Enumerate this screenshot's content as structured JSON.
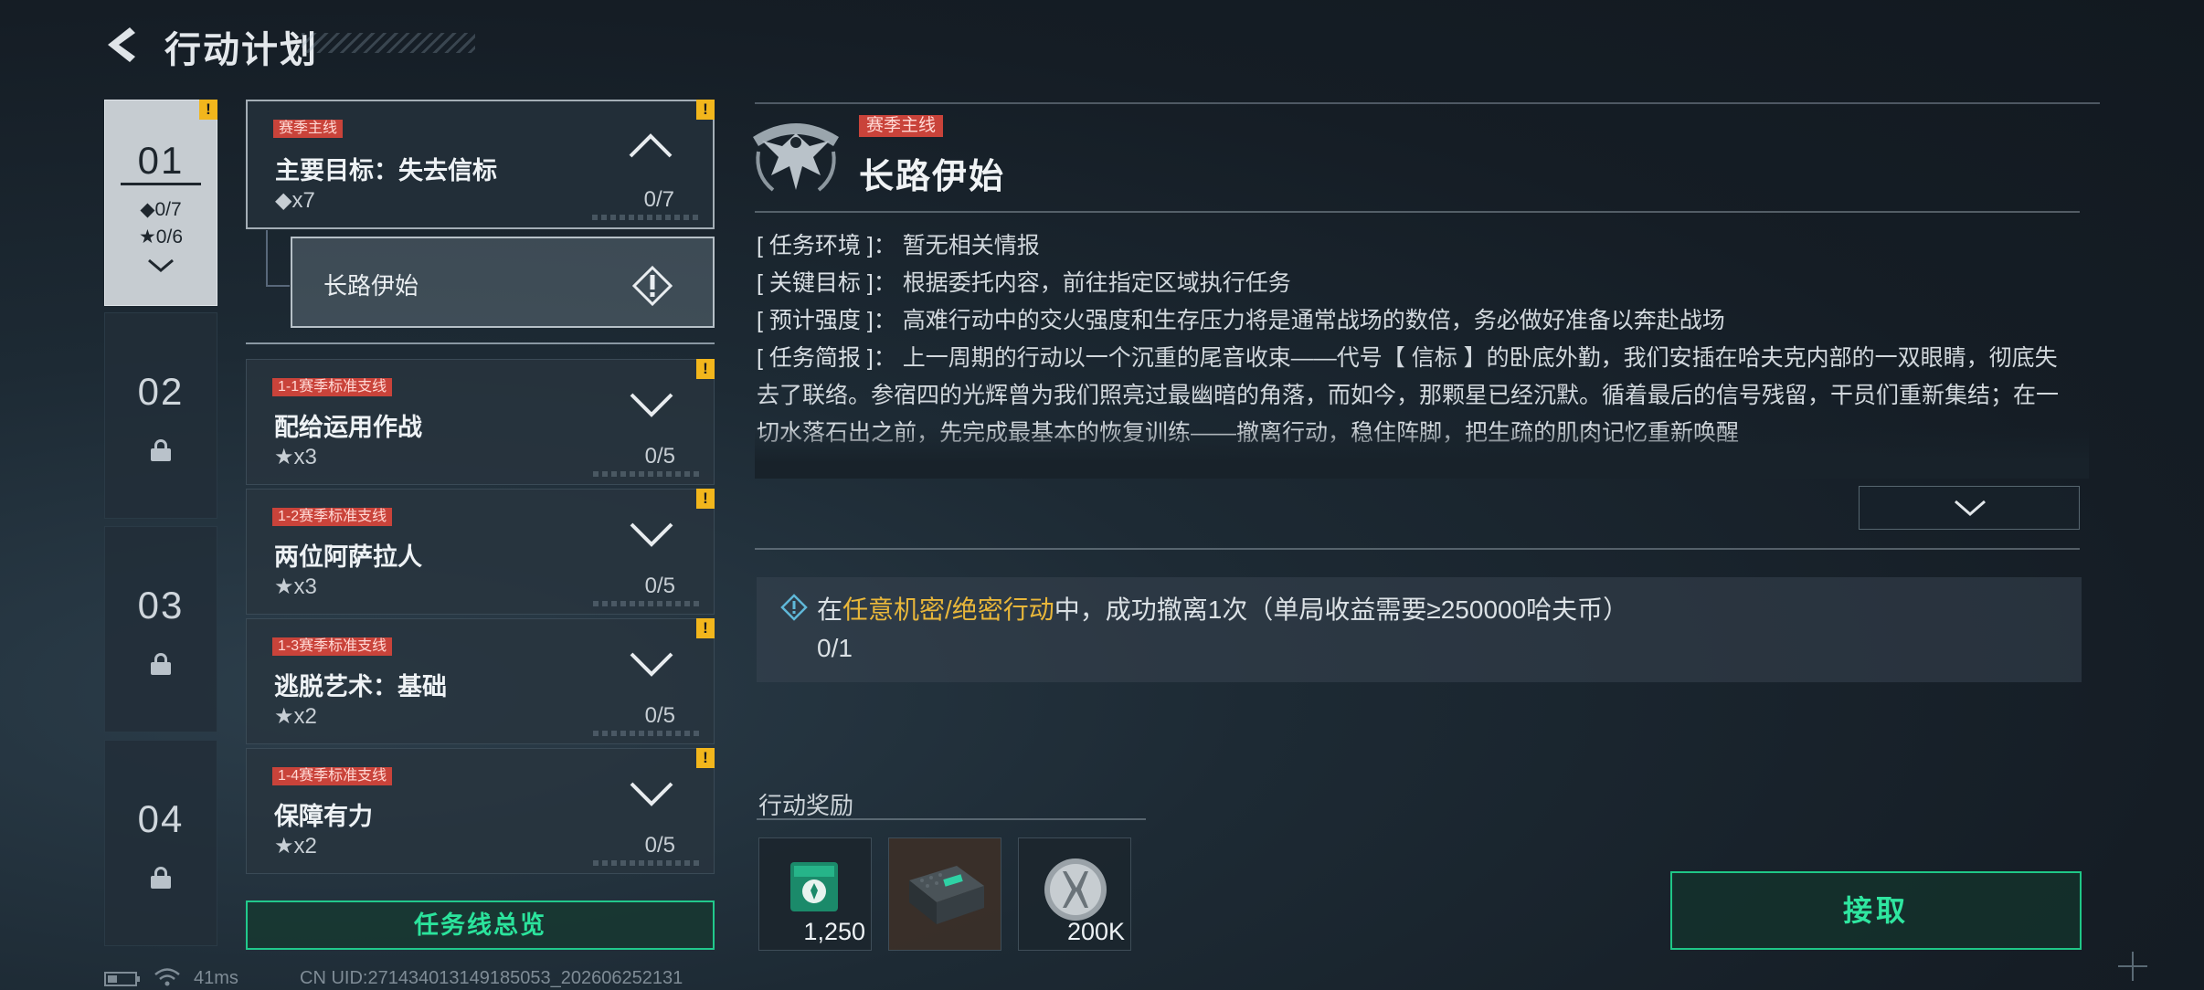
{
  "header": {
    "title": "行动计划"
  },
  "chapters": [
    {
      "num": "01",
      "stat1": "◆0/7",
      "stat2": "★0/6",
      "active": true
    },
    {
      "num": "02",
      "locked": true
    },
    {
      "num": "03",
      "locked": true
    },
    {
      "num": "04",
      "locked": true
    }
  ],
  "missions": [
    {
      "tag": "赛季主线",
      "title": "主要目标：失去信标",
      "stat": "◆x7",
      "progress": "0/7",
      "expanded": true
    },
    {
      "tag": "1-1赛季标准支线",
      "title": "配给运用作战",
      "stat": "★x3",
      "progress": "0/5"
    },
    {
      "tag": "1-2赛季标准支线",
      "title": "两位阿萨拉人",
      "stat": "★x3",
      "progress": "0/5"
    },
    {
      "tag": "1-3赛季标准支线",
      "title": "逃脱艺术：基础",
      "stat": "★x2",
      "progress": "0/5"
    },
    {
      "tag": "1-4赛季标准支线",
      "title": "保障有力",
      "stat": "★x2",
      "progress": "0/5"
    }
  ],
  "sub_item": {
    "label": "长路伊始"
  },
  "overview_button": "任务线总览",
  "badge_text": "!",
  "detail": {
    "tag": "赛季主线",
    "title": "长路伊始",
    "env_key": "[ 任务环境 ]",
    "env_val": "：  暂无相关情报",
    "goal_key": "[ 关键目标 ]",
    "goal_val": "：  根据委托内容，前往指定区域执行任务",
    "intensity_key": "[ 预计强度 ]",
    "intensity_val": "：  高难行动中的交火强度和生存压力将是通常战场的数倍，务必做好准备以奔赴战场",
    "brief_key": "[ 任务简报 ]",
    "brief_val": "：  上一周期的行动以一个沉重的尾音收束——代号【 信标 】的卧底外勤，我们安插在哈夫克内部的一双眼睛，彻底失去了联络。参宿四的光辉曾为我们照亮过最幽暗的角落，而如今，那颗星已经沉默。循着最后的信号残留，干员们重新集结；在一切水落石出之前，先完成最基本的恢复训练——撤离行动，稳住阵脚，把生疏的肌肉记忆重新唤醒"
  },
  "task": {
    "pre": "在",
    "highlight": "任意机密/绝密行动",
    "post": "中，成功撤离1次（单局收益需要≥250000哈夫币）",
    "progress": "0/1"
  },
  "rewards_title": "行动奖励",
  "rewards": [
    {
      "icon": "merit-badge-icon",
      "amount": "1,250"
    },
    {
      "icon": "equipment-case-icon",
      "amount": ""
    },
    {
      "icon": "coin-icon",
      "amount": "200K"
    }
  ],
  "accept_button": "接取",
  "status_bar": {
    "ping": "41ms",
    "uid": "CN UID:271434013149185053_202606252131"
  },
  "colors": {
    "accent_green": "#21c98c",
    "tag_red": "#c9433a",
    "warn_yellow": "#f2b61c",
    "highlight_gold": "#e9b73a"
  }
}
